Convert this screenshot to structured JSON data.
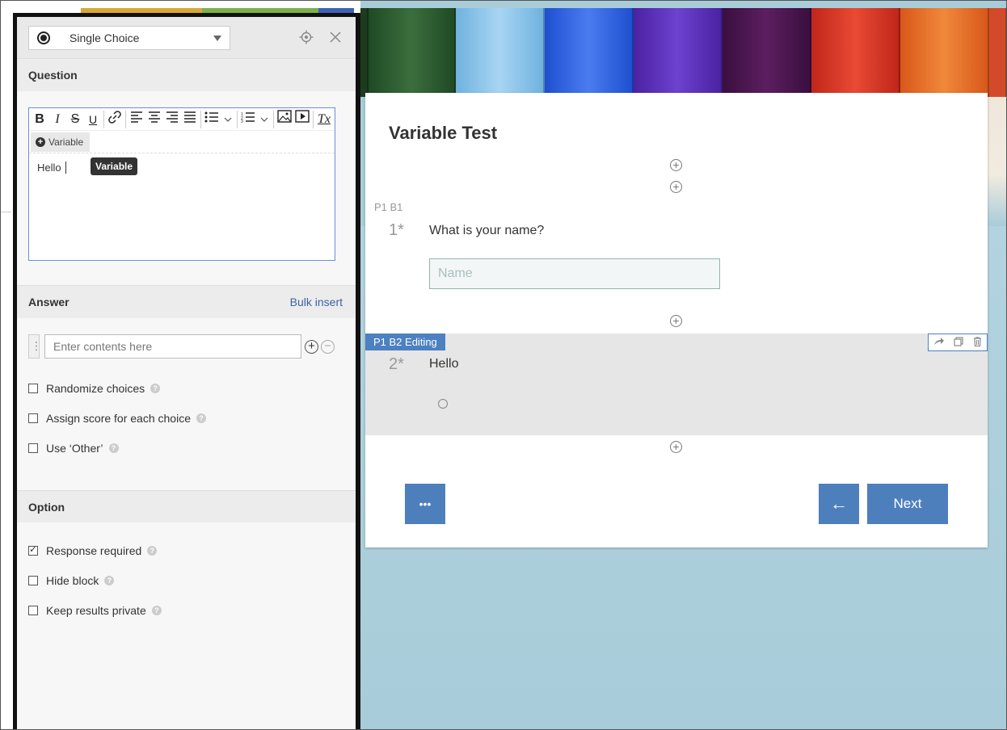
{
  "editor_panel": {
    "question_type": "Single Choice",
    "question_section": {
      "title": "Question",
      "toolbar": {
        "bold": "B",
        "italic": "I",
        "strike": "S",
        "underline": "U",
        "link_icon": "link-icon",
        "clear_format": "Tx"
      },
      "variable_button": "Variable",
      "editor_text": "Hello",
      "tooltip": "Variable"
    },
    "answer_section": {
      "title": "Answer",
      "bulk_insert": "Bulk insert",
      "input_placeholder": "Enter contents here",
      "checkboxes": [
        {
          "label": "Randomize choices",
          "checked": false
        },
        {
          "label": "Assign score for each choice",
          "checked": false
        },
        {
          "label": "Use ‘Other’",
          "checked": false
        }
      ]
    },
    "option_section": {
      "title": "Option",
      "checkboxes": [
        {
          "label": "Response required",
          "checked": true
        },
        {
          "label": "Hide block",
          "checked": false
        },
        {
          "label": "Keep results private",
          "checked": false
        }
      ]
    }
  },
  "survey": {
    "title": "Variable Test",
    "block1": {
      "label": "P1 B1",
      "number": "1*",
      "question": "What is your name?",
      "placeholder": "Name"
    },
    "block2": {
      "tag": "P1 B2 Editing",
      "number": "2*",
      "question": "Hello"
    },
    "buttons": {
      "more": "•••",
      "back": "←",
      "next": "Next"
    }
  },
  "colors": {
    "accent": "#4e7fbd",
    "link": "#3b63a5",
    "pencils": [
      "#2e5a2e",
      "#8fc3e8",
      "#2d5fe0",
      "#5a2fb8",
      "#4a1650",
      "#d8301e",
      "#e56a1e"
    ]
  }
}
